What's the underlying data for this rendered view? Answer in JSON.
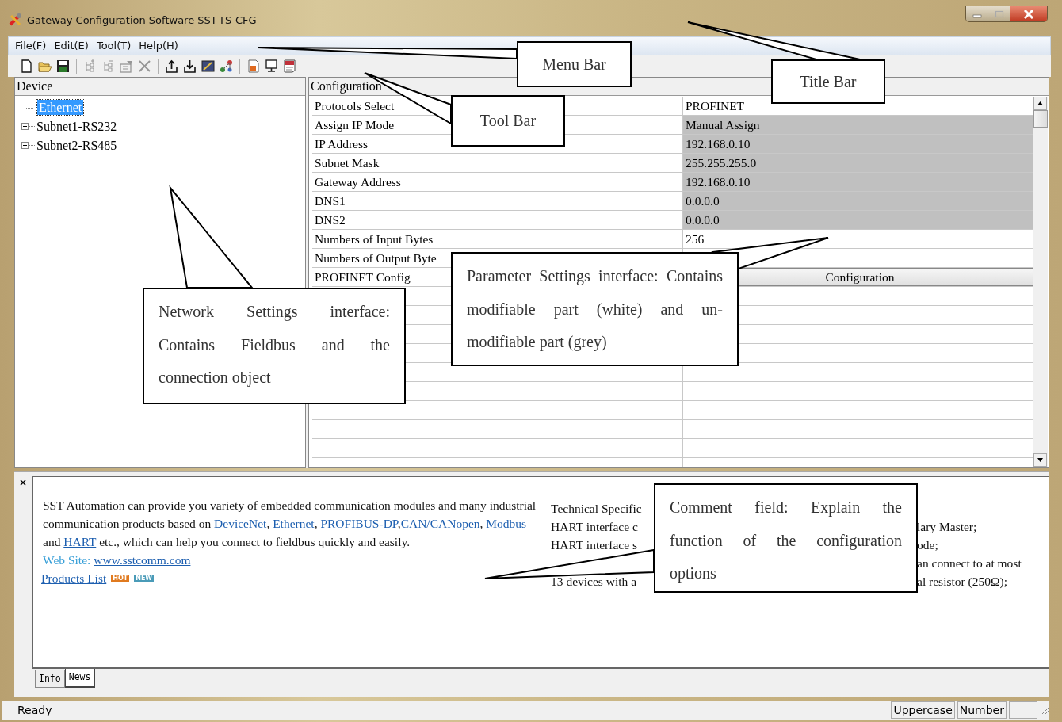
{
  "window": {
    "title": "Gateway Configuration Software SST-TS-CFG"
  },
  "menu": [
    {
      "label": "File(F)"
    },
    {
      "label": "Edit(E)"
    },
    {
      "label": "Tool(T)"
    },
    {
      "label": "Help(H)"
    }
  ],
  "toolbar": [
    [
      {
        "kind": "new",
        "disabled": false
      },
      {
        "kind": "open",
        "disabled": false
      },
      {
        "kind": "save",
        "disabled": false
      }
    ],
    [
      {
        "kind": "addnode",
        "disabled": true
      },
      {
        "kind": "removenode",
        "disabled": true
      },
      {
        "kind": "properties",
        "disabled": true
      },
      {
        "kind": "delete",
        "disabled": true
      }
    ],
    [
      {
        "kind": "upload",
        "disabled": false
      },
      {
        "kind": "download",
        "disabled": false
      },
      {
        "kind": "chart",
        "disabled": false
      },
      {
        "kind": "tools",
        "disabled": false
      }
    ],
    [
      {
        "kind": "report",
        "disabled": false
      },
      {
        "kind": "monitor",
        "disabled": false
      },
      {
        "kind": "doc",
        "disabled": false
      }
    ]
  ],
  "device_pane": {
    "title": "Device",
    "tree": [
      {
        "label": "Ethernet",
        "kind": "leaf",
        "selected": true
      },
      {
        "label": "Subnet1-RS232",
        "kind": "group",
        "expanded": false,
        "selected": false
      },
      {
        "label": "Subnet2-RS485",
        "kind": "group",
        "expanded": false,
        "selected": false
      }
    ]
  },
  "config_pane": {
    "title": "Configuration",
    "rows": [
      {
        "name": "Protocols Select",
        "value": "PROFINET",
        "kind": "text",
        "editable": true
      },
      {
        "name": "Assign IP Mode",
        "value": "Manual Assign",
        "kind": "text",
        "editable": false
      },
      {
        "name": "IP Address",
        "value": "192.168.0.10",
        "kind": "text",
        "editable": false
      },
      {
        "name": "Subnet Mask",
        "value": "255.255.255.0",
        "kind": "text",
        "editable": false
      },
      {
        "name": "Gateway Address",
        "value": "192.168.0.10",
        "kind": "text",
        "editable": false
      },
      {
        "name": "DNS1",
        "value": "0.0.0.0",
        "kind": "text",
        "editable": false
      },
      {
        "name": "DNS2",
        "value": "0.0.0.0",
        "kind": "text",
        "editable": false
      },
      {
        "name": "Numbers of Input Bytes",
        "value": "256",
        "kind": "text",
        "editable": true
      },
      {
        "name": "Numbers of Output Byte",
        "kind": "text"
      },
      {
        "name": "PROFINET Config",
        "value": "Configuration",
        "kind": "button"
      }
    ]
  },
  "comment_panel": {
    "close": "×",
    "intro": [
      {
        "text": "SST Automation can provide you variety of embedded communication modules and many industrial communication products based on ",
        "link": false
      },
      {
        "text": "DeviceNet",
        "link": true
      },
      {
        "text": ", ",
        "link": false
      },
      {
        "text": "Ethernet",
        "link": true
      },
      {
        "text": ", ",
        "link": false
      },
      {
        "text": "PROFIBUS-DP",
        "link": true
      },
      {
        "text": ",",
        "link": false
      },
      {
        "text": "CAN/CANopen",
        "link": true
      },
      {
        "text": ", ",
        "link": false
      },
      {
        "text": "Modbus",
        "link": true
      },
      {
        "text": " and ",
        "link": false
      },
      {
        "text": "HART",
        "link": true
      },
      {
        "text": " etc., which can help you connect to fieldbus quickly and easily.",
        "link": false
      }
    ],
    "website": {
      "label": "Web Site:",
      "link": "www.sstcomm.com"
    },
    "products": {
      "link": "Products List",
      "badges": [
        {
          "text": "HOT",
          "color": "#e07a1f"
        },
        {
          "text": "NEW",
          "color": "#4a9bb8"
        }
      ]
    },
    "spec_lines": [
      {
        "left": "Technical Specific"
      },
      {
        "left": "HART interface c",
        "right": "lary Master;"
      },
      {
        "left": "HART interface s",
        "right": "ode;"
      },
      {
        "right": "an connect to at most"
      },
      {
        "left": "13 devices with a",
        "right": "al resistor (250Ω);"
      }
    ],
    "tabs": [
      {
        "label": "Info",
        "selected": false
      },
      {
        "label": "News",
        "selected": true
      }
    ]
  },
  "status_bar": {
    "message": "Ready",
    "panes": [
      "Uppercase",
      "Number"
    ]
  },
  "callouts": [
    {
      "text": "Menu Bar"
    },
    {
      "text": "Title Bar"
    },
    {
      "text": "Tool Bar"
    },
    {
      "text": "Network Settings interface: Contains Fieldbus and the connection object"
    },
    {
      "text": "Parameter Settings interface: Contains modifiable part (white) and un-modifiable part (grey)"
    },
    {
      "text": "Comment field: Explain the function of the configuration options"
    }
  ]
}
